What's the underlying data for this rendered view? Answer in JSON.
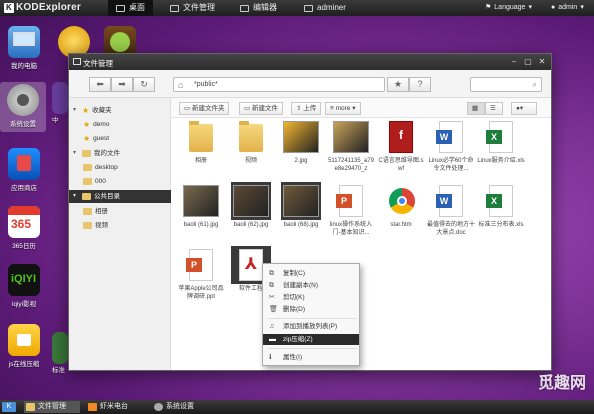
{
  "topbar": {
    "logo": "KODExplorer",
    "nav": [
      "桌面",
      "文件管理",
      "编辑器",
      "adminer"
    ],
    "language": "Language",
    "user": "admin"
  },
  "desktop_icons": [
    {
      "label": "我的电脑",
      "icon": "computer-icon"
    },
    {
      "label": "系统设置",
      "icon": "settings-gear-icon"
    },
    {
      "label": "应用商店",
      "icon": "app-store-icon"
    },
    {
      "label": "365日历",
      "icon": "calendar-icon"
    },
    {
      "label": "iqiyi影视",
      "icon": "iqiyi-icon"
    },
    {
      "label": "js在线压缩",
      "icon": "js-compress-icon"
    }
  ],
  "desktop_partial_labels": [
    "中",
    "",
    "",
    "",
    "",
    "",
    "画",
    "标准"
  ],
  "window": {
    "title": "文件管理",
    "path": "*public*",
    "toolbar": {
      "new_folder": "新建文件夹",
      "new_file": "新建文件",
      "upload": "上传",
      "more": "more"
    },
    "sidebar": [
      {
        "label": "收藏夹",
        "level": 0,
        "type": "star",
        "open": true
      },
      {
        "label": "demo",
        "level": 1,
        "type": "star"
      },
      {
        "label": "guest",
        "level": 1,
        "type": "star"
      },
      {
        "label": "我的文件",
        "level": 0,
        "type": "folder",
        "open": true
      },
      {
        "label": "desktop",
        "level": 1,
        "type": "folder"
      },
      {
        "label": "000",
        "level": 1,
        "type": "folder"
      },
      {
        "label": "公共目录",
        "level": 0,
        "type": "folder",
        "open": true,
        "selected": true
      },
      {
        "label": "相册",
        "level": 1,
        "type": "folder"
      },
      {
        "label": "视频",
        "level": 1,
        "type": "folder"
      }
    ],
    "files": [
      {
        "name": "相册",
        "kind": "folder"
      },
      {
        "name": "视频",
        "kind": "folder"
      },
      {
        "name": "2.jpg",
        "kind": "image",
        "color": "#f2b630"
      },
      {
        "name": "5117241135_a79e8e29470_z",
        "kind": "image",
        "color": "#c9a35a"
      },
      {
        "name": "C语言思维导图.swf",
        "kind": "swf"
      },
      {
        "name": "Linux必学60个命令文件处理...",
        "kind": "word"
      },
      {
        "name": "Linux服务介绍.xls",
        "kind": "excel"
      },
      {
        "name": "baoli (61).jpg",
        "kind": "image",
        "color": "#7a6a4e"
      },
      {
        "name": "baoli (62).jpg",
        "kind": "image",
        "color": "#5b4a36",
        "selected": true
      },
      {
        "name": "baoli (68).jpg",
        "kind": "image",
        "color": "#6f5a3c",
        "selected": true
      },
      {
        "name": "linux操作系统入门-基本知识...",
        "kind": "ppt"
      },
      {
        "name": "star.htm",
        "kind": "chrome"
      },
      {
        "name": "最值得去的地方十大景点.doc",
        "kind": "word"
      },
      {
        "name": "标准三分布表.xls",
        "kind": "excel"
      },
      {
        "name": "苹果Apple公司品牌调研.ppt",
        "kind": "ppt"
      },
      {
        "name": "软件工程",
        "kind": "pdf",
        "selected": true
      }
    ]
  },
  "context_menu": {
    "items": [
      {
        "label": "复制(C)",
        "icon": "copy-icon"
      },
      {
        "label": "创建副本(N)",
        "icon": "duplicate-icon"
      },
      {
        "label": "剪切(K)",
        "icon": "scissors-icon"
      },
      {
        "label": "删除(D)",
        "icon": "trash-icon"
      },
      {
        "label": "添加到播放列表(P)",
        "icon": "music-icon"
      },
      {
        "label": "zip压缩(Z)",
        "icon": "folder-icon",
        "highlighted": true
      },
      {
        "label": "属性(I)",
        "icon": "info-icon"
      }
    ]
  },
  "taskbar": [
    {
      "label": "文件管理",
      "active": true
    },
    {
      "label": "虾米电台",
      "active": false
    },
    {
      "label": "系统设置",
      "active": false
    }
  ],
  "watermark": "觅趣网",
  "colors": {
    "topbar": "#2a2a2a",
    "desktop": "#8a3aa3",
    "selection": "#2a2a2a",
    "folder": "#e8c56a"
  }
}
